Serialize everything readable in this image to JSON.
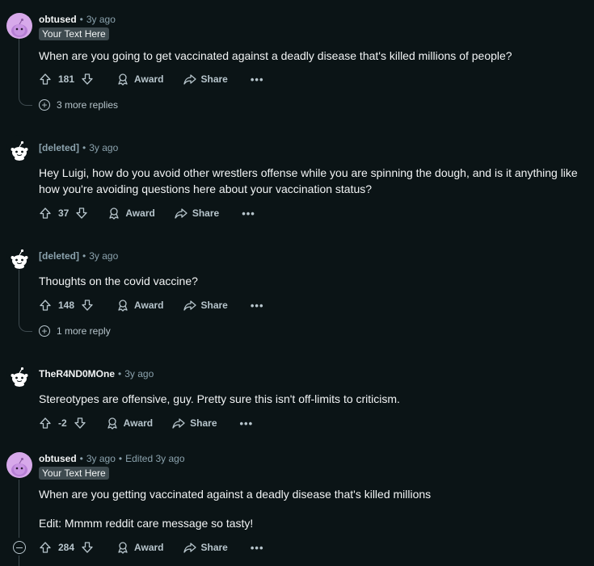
{
  "comments": [
    {
      "username": "obtused",
      "separator": "•",
      "time": "3y ago",
      "flair": "Your Text Here",
      "body": "When are you going to get vaccinated against a deadly disease that's killed millions of people?",
      "score": "181",
      "award_label": "Award",
      "share_label": "Share",
      "more_label": "•••",
      "more_replies": "3 more replies"
    },
    {
      "username": "[deleted]",
      "separator": "•",
      "time": "3y ago",
      "body": "Hey Luigi, how do you avoid other wrestlers offense while you are spinning the dough, and is it anything like how you're avoiding questions here about your vaccination status?",
      "score": "37",
      "award_label": "Award",
      "share_label": "Share",
      "more_label": "•••"
    },
    {
      "username": "[deleted]",
      "separator": "•",
      "time": "3y ago",
      "body": "Thoughts on the covid vaccine?",
      "score": "148",
      "award_label": "Award",
      "share_label": "Share",
      "more_label": "•••",
      "more_replies": "1 more reply"
    },
    {
      "username": "TheR4ND0MOne",
      "separator": "•",
      "time": "3y ago",
      "body": "Stereotypes are offensive, guy. Pretty sure this isn't off-limits to criticism.",
      "score": "-2",
      "award_label": "Award",
      "share_label": "Share",
      "more_label": "•••"
    },
    {
      "username": "obtused",
      "separator": "•",
      "time": "3y ago",
      "edited": "Edited 3y ago",
      "flair": "Your Text Here",
      "body_lines": [
        "When are you getting vaccinated against a deadly disease that's killed millions",
        "Edit: Mmmm reddit care message so tasty!"
      ],
      "score": "284",
      "award_label": "Award",
      "share_label": "Share",
      "more_label": "•••"
    }
  ],
  "colors": {
    "background": "#0b1416",
    "text": "#f2f4f5",
    "muted": "#8ba2ad",
    "flair_bg": "#3e4a4f",
    "avatar_purple": "#d7a9ea"
  },
  "icons": [
    "upvote-icon",
    "downvote-icon",
    "award-icon",
    "share-icon",
    "more-icon",
    "plus-circle-icon",
    "minus-circle-icon",
    "snoo-avatar-icon"
  ]
}
